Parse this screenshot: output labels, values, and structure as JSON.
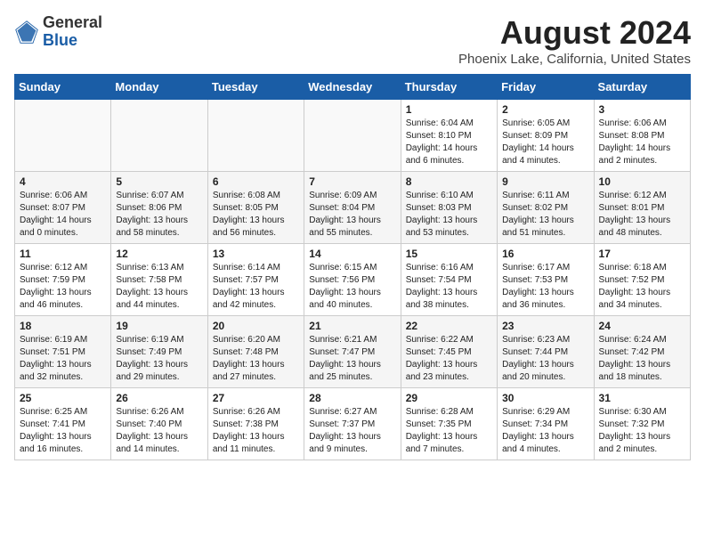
{
  "header": {
    "logo_line1": "General",
    "logo_line2": "Blue",
    "month": "August 2024",
    "location": "Phoenix Lake, California, United States"
  },
  "days_of_week": [
    "Sunday",
    "Monday",
    "Tuesday",
    "Wednesday",
    "Thursday",
    "Friday",
    "Saturday"
  ],
  "weeks": [
    [
      {
        "day": "",
        "info": ""
      },
      {
        "day": "",
        "info": ""
      },
      {
        "day": "",
        "info": ""
      },
      {
        "day": "",
        "info": ""
      },
      {
        "day": "1",
        "info": "Sunrise: 6:04 AM\nSunset: 8:10 PM\nDaylight: 14 hours\nand 6 minutes."
      },
      {
        "day": "2",
        "info": "Sunrise: 6:05 AM\nSunset: 8:09 PM\nDaylight: 14 hours\nand 4 minutes."
      },
      {
        "day": "3",
        "info": "Sunrise: 6:06 AM\nSunset: 8:08 PM\nDaylight: 14 hours\nand 2 minutes."
      }
    ],
    [
      {
        "day": "4",
        "info": "Sunrise: 6:06 AM\nSunset: 8:07 PM\nDaylight: 14 hours\nand 0 minutes."
      },
      {
        "day": "5",
        "info": "Sunrise: 6:07 AM\nSunset: 8:06 PM\nDaylight: 13 hours\nand 58 minutes."
      },
      {
        "day": "6",
        "info": "Sunrise: 6:08 AM\nSunset: 8:05 PM\nDaylight: 13 hours\nand 56 minutes."
      },
      {
        "day": "7",
        "info": "Sunrise: 6:09 AM\nSunset: 8:04 PM\nDaylight: 13 hours\nand 55 minutes."
      },
      {
        "day": "8",
        "info": "Sunrise: 6:10 AM\nSunset: 8:03 PM\nDaylight: 13 hours\nand 53 minutes."
      },
      {
        "day": "9",
        "info": "Sunrise: 6:11 AM\nSunset: 8:02 PM\nDaylight: 13 hours\nand 51 minutes."
      },
      {
        "day": "10",
        "info": "Sunrise: 6:12 AM\nSunset: 8:01 PM\nDaylight: 13 hours\nand 48 minutes."
      }
    ],
    [
      {
        "day": "11",
        "info": "Sunrise: 6:12 AM\nSunset: 7:59 PM\nDaylight: 13 hours\nand 46 minutes."
      },
      {
        "day": "12",
        "info": "Sunrise: 6:13 AM\nSunset: 7:58 PM\nDaylight: 13 hours\nand 44 minutes."
      },
      {
        "day": "13",
        "info": "Sunrise: 6:14 AM\nSunset: 7:57 PM\nDaylight: 13 hours\nand 42 minutes."
      },
      {
        "day": "14",
        "info": "Sunrise: 6:15 AM\nSunset: 7:56 PM\nDaylight: 13 hours\nand 40 minutes."
      },
      {
        "day": "15",
        "info": "Sunrise: 6:16 AM\nSunset: 7:54 PM\nDaylight: 13 hours\nand 38 minutes."
      },
      {
        "day": "16",
        "info": "Sunrise: 6:17 AM\nSunset: 7:53 PM\nDaylight: 13 hours\nand 36 minutes."
      },
      {
        "day": "17",
        "info": "Sunrise: 6:18 AM\nSunset: 7:52 PM\nDaylight: 13 hours\nand 34 minutes."
      }
    ],
    [
      {
        "day": "18",
        "info": "Sunrise: 6:19 AM\nSunset: 7:51 PM\nDaylight: 13 hours\nand 32 minutes."
      },
      {
        "day": "19",
        "info": "Sunrise: 6:19 AM\nSunset: 7:49 PM\nDaylight: 13 hours\nand 29 minutes."
      },
      {
        "day": "20",
        "info": "Sunrise: 6:20 AM\nSunset: 7:48 PM\nDaylight: 13 hours\nand 27 minutes."
      },
      {
        "day": "21",
        "info": "Sunrise: 6:21 AM\nSunset: 7:47 PM\nDaylight: 13 hours\nand 25 minutes."
      },
      {
        "day": "22",
        "info": "Sunrise: 6:22 AM\nSunset: 7:45 PM\nDaylight: 13 hours\nand 23 minutes."
      },
      {
        "day": "23",
        "info": "Sunrise: 6:23 AM\nSunset: 7:44 PM\nDaylight: 13 hours\nand 20 minutes."
      },
      {
        "day": "24",
        "info": "Sunrise: 6:24 AM\nSunset: 7:42 PM\nDaylight: 13 hours\nand 18 minutes."
      }
    ],
    [
      {
        "day": "25",
        "info": "Sunrise: 6:25 AM\nSunset: 7:41 PM\nDaylight: 13 hours\nand 16 minutes."
      },
      {
        "day": "26",
        "info": "Sunrise: 6:26 AM\nSunset: 7:40 PM\nDaylight: 13 hours\nand 14 minutes."
      },
      {
        "day": "27",
        "info": "Sunrise: 6:26 AM\nSunset: 7:38 PM\nDaylight: 13 hours\nand 11 minutes."
      },
      {
        "day": "28",
        "info": "Sunrise: 6:27 AM\nSunset: 7:37 PM\nDaylight: 13 hours\nand 9 minutes."
      },
      {
        "day": "29",
        "info": "Sunrise: 6:28 AM\nSunset: 7:35 PM\nDaylight: 13 hours\nand 7 minutes."
      },
      {
        "day": "30",
        "info": "Sunrise: 6:29 AM\nSunset: 7:34 PM\nDaylight: 13 hours\nand 4 minutes."
      },
      {
        "day": "31",
        "info": "Sunrise: 6:30 AM\nSunset: 7:32 PM\nDaylight: 13 hours\nand 2 minutes."
      }
    ]
  ]
}
